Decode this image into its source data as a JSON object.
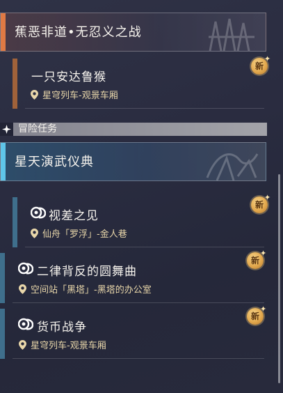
{
  "colors": {
    "main_accent": "#e07a44",
    "adventure_accent": "#5fc5e8",
    "badge_gold": "#e2a84d",
    "location_text": "#e9d7aa"
  },
  "main_quest": {
    "title": "蕉恶非道•无忍义之战",
    "missions": [
      {
        "name": "一只安达鲁猴",
        "location": "星穹列车-观景车厢",
        "badge": "新",
        "icon": "none"
      }
    ]
  },
  "section": {
    "label": "冒险任务",
    "icon": "diamond-star-icon"
  },
  "adventure_quest": {
    "title": "星天演武仪典",
    "missions": [
      {
        "name": "视差之见",
        "location": "仙舟「罗浮」-金人巷",
        "badge": "新",
        "icon": "adventure-mission-icon"
      },
      {
        "name": "二律背反的圆舞曲",
        "location": "空间站「黑塔」-黑塔的办公室",
        "badge": "新",
        "icon": "adventure-mission-icon"
      },
      {
        "name": "货币战争",
        "location": "星穹列车-观景车厢",
        "badge": "新",
        "icon": "adventure-mission-icon"
      }
    ]
  }
}
